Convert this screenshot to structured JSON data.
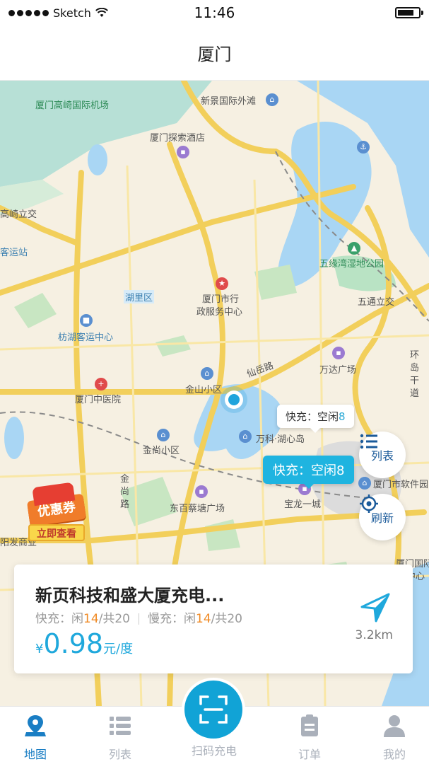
{
  "status": {
    "carrier": "Sketch",
    "time": "11:46"
  },
  "nav": {
    "title": "厦门"
  },
  "map": {
    "labels": {
      "airport": "厦门高崎国际机场",
      "xinjing": "新景国际外滩",
      "hotel": "厦门探索酒店",
      "gaoqi_junction": "高崎立交",
      "bus_station": "客运站",
      "wetland": "五缘湾湿地公园",
      "wutong": "五通立交",
      "huli": "湖里区",
      "gov_center_1": "厦门市行",
      "gov_center_2": "政服务中心",
      "fanghu": "枋湖客运中心",
      "wanda": "万达广场",
      "jinshan": "金山小区",
      "xiamen_hospital": "厦门中医院",
      "hudao": "万科·湖心岛",
      "jinshang": "金尚小区",
      "dongzhai": "东百蔡塘广场",
      "baolong": "宝龙一城",
      "software_park": "厦门市软件园",
      "xianyue_road": "仙岳路",
      "jinshang_road": "金尚路",
      "huandao_road": "环岛干道",
      "bottom_left": "阳发商业",
      "bottom_right_1": "厦门国际",
      "bottom_right_2": "中心"
    },
    "bubble_small": {
      "prefix": "快充：空闲",
      "count": "8"
    },
    "bubble_active": {
      "prefix": "快充：空闲",
      "count": "8"
    },
    "list_button": "列表",
    "refresh_button": "刷新",
    "coupon": {
      "tag": "优惠券",
      "cta": "立即查看"
    }
  },
  "station": {
    "name": "新页科技和盛大厦充电...",
    "fast_label": "快充：闲",
    "fast_free": "14",
    "fast_total": "/共20",
    "slow_label": "慢充：闲",
    "slow_free": "14",
    "slow_total": "/共20",
    "currency": "¥",
    "price": "0.98",
    "unit": "元/度",
    "distance": "3.2km"
  },
  "tabs": {
    "map": "地图",
    "list": "列表",
    "scan": "扫码充电",
    "orders": "订单",
    "mine": "我的"
  },
  "colors": {
    "accent": "#1fb4e0",
    "highlight": "#f08a24",
    "tab_active": "#1a7ec4"
  }
}
